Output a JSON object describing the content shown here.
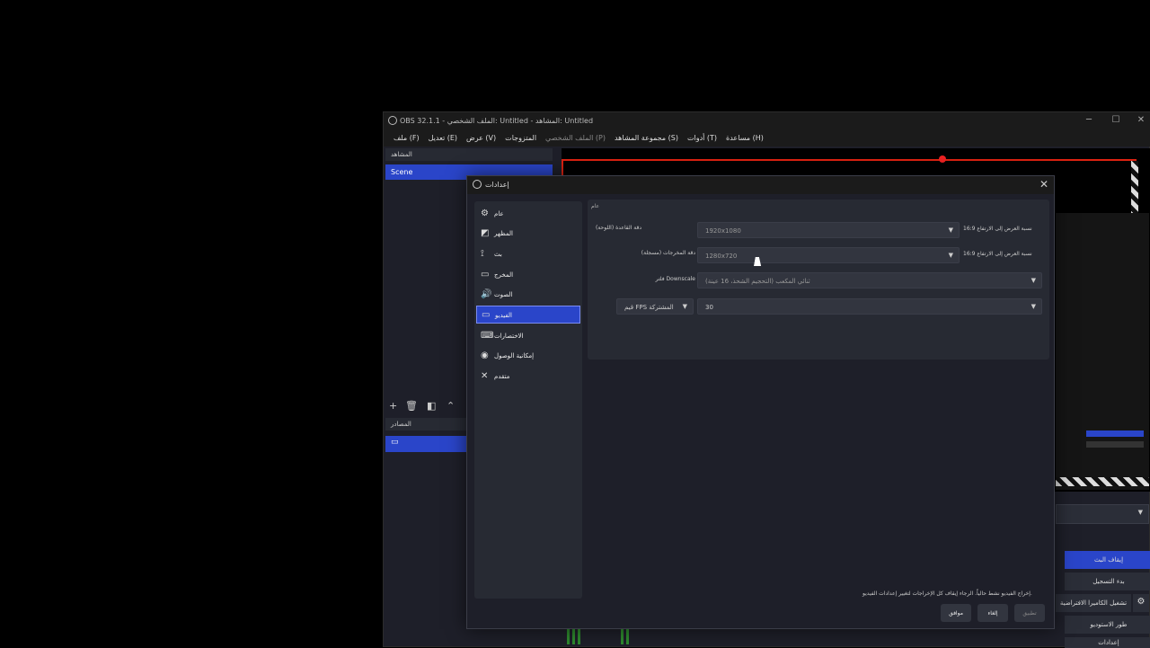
{
  "obs": {
    "title": "OBS 32.1.1 - الملف الشخصي: Untitled - المشاهد: Untitled",
    "controls": {
      "minimize": "─",
      "maximize": "☐",
      "close": "✕"
    },
    "menu": [
      "ملف (F)",
      "تعديل (E)",
      "عرض (V)",
      "المتزوجات",
      "الملف الشخصي (P)",
      "مجموعة المشاهد (S)",
      "أدوات (T)",
      "مساعدة (H)"
    ],
    "scenes_header": "المشاهد",
    "scene_item": "Scene",
    "sources_header": "المصادر",
    "dock_buttons": [
      "إيقاف البث",
      "بدء التسجيل",
      "تشغيل الكاميرا الافتراضية",
      "طور الاستوديو",
      "إعدادات"
    ]
  },
  "settings": {
    "title": "إعدادات",
    "close": "✕",
    "nav": [
      {
        "label": "عام",
        "icon": "⚙"
      },
      {
        "label": "المظهر",
        "icon": "◩"
      },
      {
        "label": "بث",
        "icon": "⟟"
      },
      {
        "label": "المخرج",
        "icon": "▭"
      },
      {
        "label": "الصوت",
        "icon": "🔊"
      },
      {
        "label": "الفيديو",
        "icon": "▭"
      },
      {
        "label": "الاختصارات",
        "icon": "⌨"
      },
      {
        "label": "إمكانية الوصول",
        "icon": "◉"
      },
      {
        "label": "متقدم",
        "icon": "✕"
      }
    ],
    "section": "عام",
    "base_label": "دقة القاعدة (اللوحة)",
    "base_value": "1920x1080",
    "base_aspect": "نسبة العرض إلى الارتفاع 16:9",
    "output_label": "دقة المخرجات (مسجلة)",
    "output_value": "1280x720",
    "output_aspect": "نسبة العرض إلى الارتفاع 16:9",
    "downscale_label": "فلتر Downscale",
    "downscale_value": "ثنائي المكعب (التحجيم الشحذ، 16 عينة)",
    "fps_label": "قيم FPS المشتركة",
    "fps_value": "30",
    "warning": "إخراج الفيديو نشط حالياً. الرجاء إيقاف كل الإخراجات لتغيير إعدادات الفيديو.",
    "ok": "موافق",
    "cancel": "إلغاء",
    "apply": "تطبيق"
  },
  "colors": {
    "accent": "#2a45c9",
    "background": "#1e1f29",
    "panel": "#272a33",
    "record": "#d21"
  }
}
